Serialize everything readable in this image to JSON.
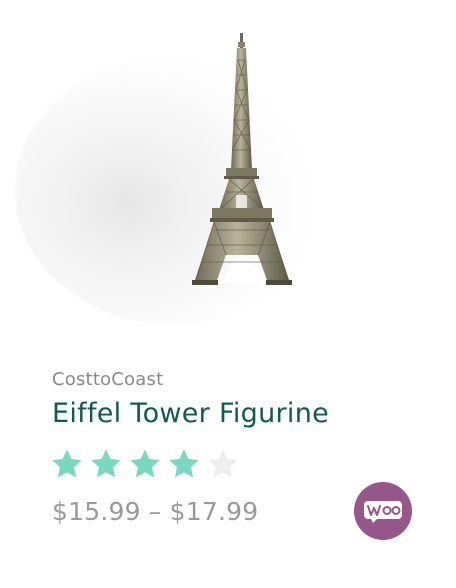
{
  "product": {
    "image_icon": "eiffel-tower-figurine-image",
    "vendor": "CosttoCoast",
    "title": "Eiffel Tower Figurine",
    "rating": {
      "value": 4,
      "max": 5
    },
    "price": "$15.99 – $17.99"
  },
  "badge": {
    "icon": "woocommerce-logo",
    "text": "woo"
  },
  "colors": {
    "title": "#0e5b52",
    "star_filled": "#79d9c0",
    "star_empty": "#eeeeee",
    "vendor": "#8a8a8a",
    "price": "#9a9a9a",
    "woo_badge": "#96588a"
  }
}
